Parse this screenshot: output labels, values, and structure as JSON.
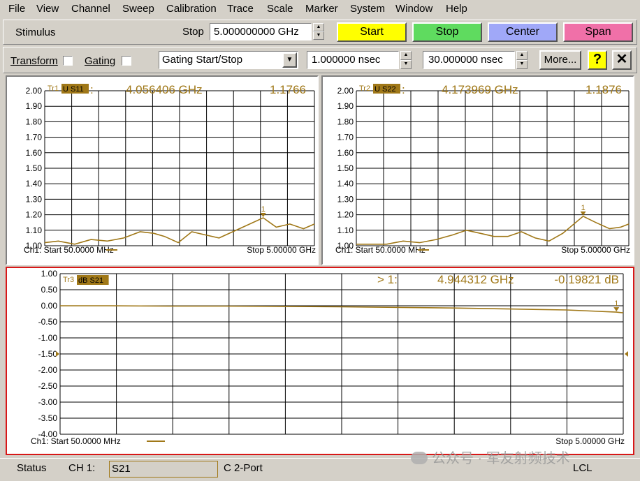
{
  "menu": [
    "File",
    "View",
    "Channel",
    "Sweep",
    "Calibration",
    "Trace",
    "Scale",
    "Marker",
    "System",
    "Window",
    "Help"
  ],
  "toolbar1": {
    "stimulus_label": "Stimulus",
    "stop_label": "Stop",
    "stop_value": "5.000000000 GHz",
    "buttons": [
      {
        "label": "Start",
        "color": "#ffff00"
      },
      {
        "label": "Stop",
        "color": "#5fdb5f"
      },
      {
        "label": "Center",
        "color": "#a0a8f8"
      },
      {
        "label": "Span",
        "color": "#f070a8"
      }
    ]
  },
  "toolbar2": {
    "transform_label": "Transform",
    "gating_label": "Gating",
    "mode_select": "Gating Start/Stop",
    "start_value": "1.000000 nsec",
    "stop_value": "30.000000 nsec",
    "more_label": "More...",
    "help_glyph": "?",
    "close_glyph": "✕"
  },
  "trace_color": "#a07818",
  "panels": [
    {
      "trace_id": "Tr1",
      "param": "U S11",
      "marker_readout_prefix": ":",
      "marker_freq": "4.056406 GHz",
      "marker_value": "1.1766",
      "yticks": [
        "2.00",
        "1.90",
        "1.80",
        "1.70",
        "1.60",
        "1.50",
        "1.40",
        "1.30",
        "1.20",
        "1.10",
        "1.00"
      ],
      "footer_start": "Ch1: Start  50.0000 MHz",
      "footer_stop": "Stop  5.00000 GHz",
      "marker_label": "1"
    },
    {
      "trace_id": "Tr2",
      "param": "U S22",
      "marker_readout_prefix": ":",
      "marker_freq": "4.173969 GHz",
      "marker_value": "1.1876",
      "yticks": [
        "2.00",
        "1.90",
        "1.80",
        "1.70",
        "1.60",
        "1.50",
        "1.40",
        "1.30",
        "1.20",
        "1.10",
        "1.00"
      ],
      "footer_start": "Ch1: Start  50.0000 MHz",
      "footer_stop": "Stop  5.00000 GHz",
      "marker_label": "1"
    },
    {
      "trace_id": "Tr3",
      "param": "dB S21",
      "marker_readout_prefix": "> 1:",
      "marker_freq": "4.944312 GHz",
      "marker_value": "-0.19821 dB",
      "yticks": [
        "1.00",
        "0.50",
        "0.00",
        "-0.50",
        "-1.00",
        "-1.50",
        "-2.00",
        "-2.50",
        "-3.00",
        "-3.50",
        "-4.00"
      ],
      "footer_start": "Ch1: Start  50.0000 MHz",
      "footer_stop": "Stop  5.00000 GHz",
      "marker_label": "1"
    }
  ],
  "chart_data": [
    {
      "type": "line",
      "x": [
        0.05,
        0.3,
        0.6,
        0.9,
        1.2,
        1.5,
        1.8,
        2.05,
        2.25,
        2.5,
        2.75,
        3.0,
        3.25,
        3.5,
        3.75,
        4.06,
        4.3,
        4.55,
        4.8,
        5.0
      ],
      "values": [
        1.02,
        1.03,
        1.01,
        1.04,
        1.03,
        1.05,
        1.09,
        1.08,
        1.06,
        1.02,
        1.09,
        1.07,
        1.05,
        1.09,
        1.13,
        1.18,
        1.12,
        1.14,
        1.11,
        1.14
      ],
      "ylim": [
        1.0,
        2.0
      ],
      "xlim": [
        0.05,
        5.0
      ]
    },
    {
      "type": "line",
      "x": [
        0.05,
        0.3,
        0.6,
        0.9,
        1.2,
        1.5,
        1.8,
        2.05,
        2.3,
        2.55,
        2.8,
        3.05,
        3.3,
        3.55,
        3.8,
        4.17,
        4.4,
        4.65,
        4.85,
        5.0
      ],
      "values": [
        1.01,
        1.01,
        1.01,
        1.03,
        1.02,
        1.04,
        1.07,
        1.1,
        1.08,
        1.06,
        1.06,
        1.09,
        1.05,
        1.03,
        1.08,
        1.19,
        1.15,
        1.11,
        1.12,
        1.14
      ],
      "ylim": [
        1.0,
        2.0
      ],
      "xlim": [
        0.05,
        5.0
      ]
    },
    {
      "type": "line",
      "x": [
        0.05,
        0.5,
        1.0,
        1.5,
        2.0,
        2.5,
        3.0,
        3.5,
        4.0,
        4.5,
        4.94,
        5.0
      ],
      "values": [
        0.0,
        0.0,
        -0.01,
        -0.01,
        -0.02,
        -0.03,
        -0.05,
        -0.07,
        -0.1,
        -0.13,
        -0.198,
        -0.22
      ],
      "ylim": [
        -4.0,
        1.0
      ],
      "xlim": [
        0.05,
        5.0
      ]
    }
  ],
  "status": {
    "status_label": "Status",
    "channel_label": "CH 1:",
    "trace_param": "S21",
    "cal_label": "C  2-Port",
    "lcl_label": "LCL"
  },
  "watermark": "公众号 · 军友射频技术"
}
